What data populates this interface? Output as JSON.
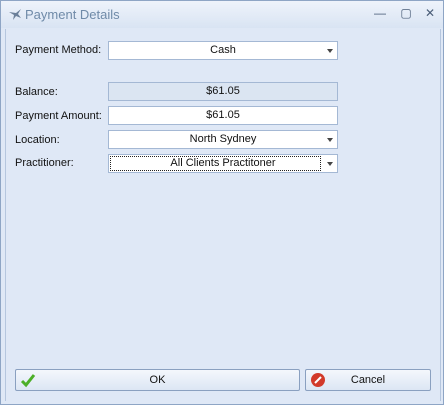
{
  "window": {
    "title": "Payment Details"
  },
  "form": {
    "payment_method": {
      "label": "Payment Method:",
      "value": "Cash"
    },
    "balance": {
      "label": "Balance:",
      "value": "$61.05"
    },
    "payment_amount": {
      "label": "Payment Amount:",
      "value": "$61.05"
    },
    "location": {
      "label": "Location:",
      "value": "North Sydney"
    },
    "practitioner": {
      "label": "Practitioner:",
      "value": "All Clients Practitoner"
    }
  },
  "buttons": {
    "ok": "OK",
    "cancel": "Cancel"
  },
  "colors": {
    "ok_icon": "#4caf28",
    "cancel_icon": "#d23a2a"
  }
}
